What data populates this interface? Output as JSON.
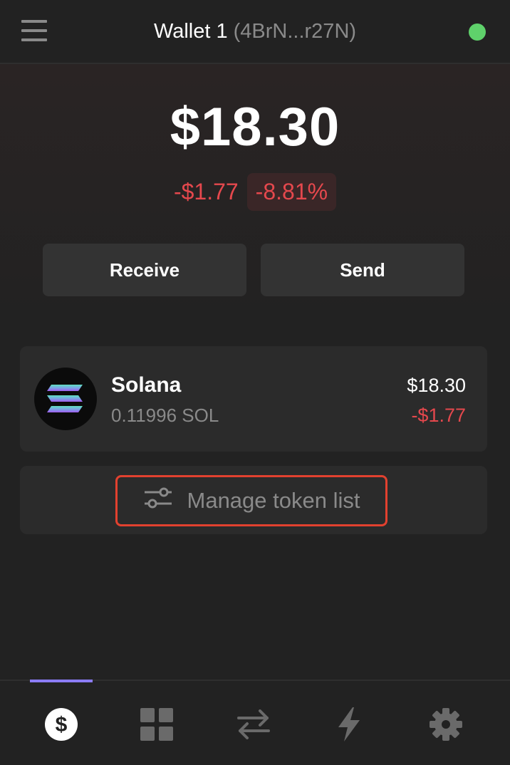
{
  "header": {
    "wallet_name": "Wallet 1",
    "wallet_address": "(4BrN...r27N)",
    "status_color": "#5fd16b",
    "menu_icon": "hamburger-menu-icon"
  },
  "portfolio": {
    "balance": "$18.30",
    "change_amount": "-$1.77",
    "change_percent": "-8.81%",
    "negative_color": "#e5484d"
  },
  "actions": {
    "receive_label": "Receive",
    "send_label": "Send"
  },
  "tokens": [
    {
      "name": "Solana",
      "amount": "0.11996 SOL",
      "value": "$18.30",
      "change": "-$1.77",
      "icon": "solana-logo-icon"
    }
  ],
  "manage": {
    "label": "Manage token list",
    "icon": "sliders-icon",
    "highlight_color": "#e2412f"
  },
  "bottom_nav": {
    "active_index": 0,
    "accent_color": "#8b7cf6",
    "items": [
      {
        "icon": "dollar-icon"
      },
      {
        "icon": "grid-icon"
      },
      {
        "icon": "swap-arrows-icon"
      },
      {
        "icon": "lightning-icon"
      },
      {
        "icon": "gear-icon"
      }
    ]
  }
}
